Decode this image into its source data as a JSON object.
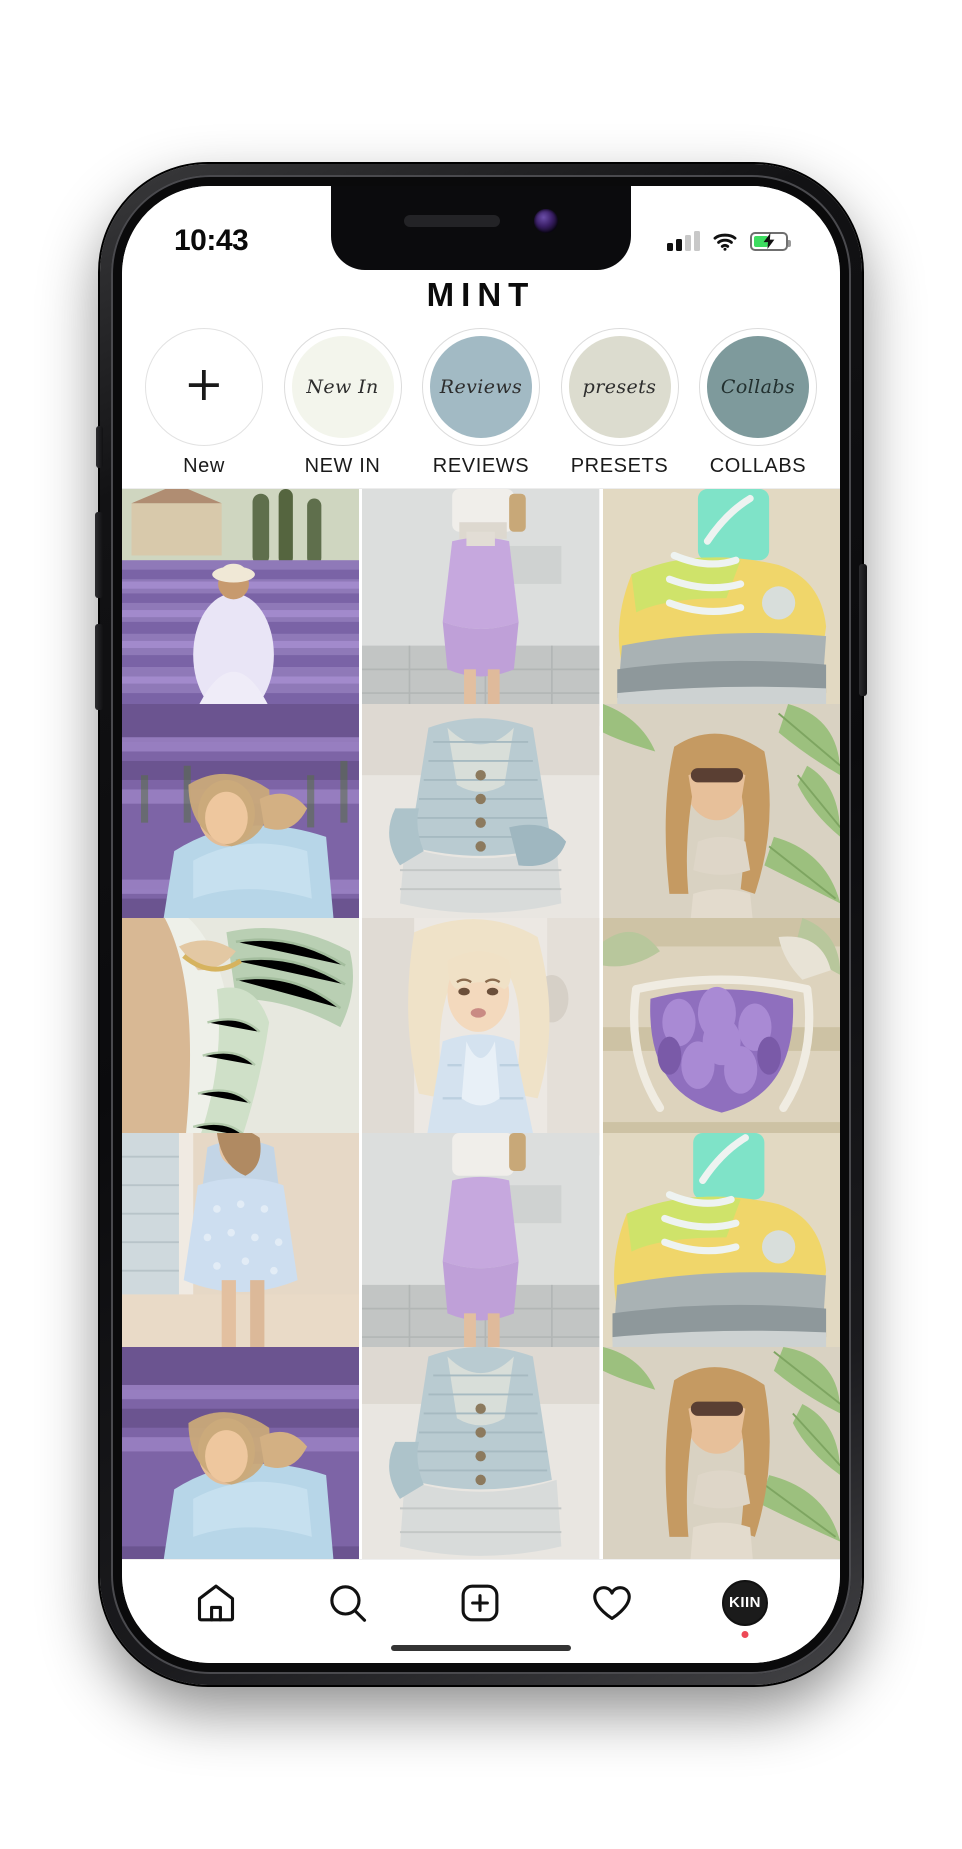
{
  "device": {
    "name": "iphone-mockup",
    "status_bar": {
      "time": "10:43",
      "signal_icon": "cellular-signal-icon",
      "signal_bars_active": 2,
      "signal_bars_total": 4,
      "wifi_icon": "wifi-icon",
      "battery_icon": "battery-charging-icon",
      "battery_level_percent": 45,
      "battery_color": "#3ddc60",
      "charging": true
    }
  },
  "header": {
    "brand_title": "MINT"
  },
  "highlights": {
    "items": [
      {
        "label": "New",
        "bubble_text": "+",
        "fill": "#ffffff",
        "ring": "#e2e2e2",
        "icon": "plus-icon"
      },
      {
        "label": "NEW IN",
        "bubble_text": "New In",
        "fill": "#f3f5ec",
        "ring": "#dcdcdc",
        "icon": "highlight-new-in"
      },
      {
        "label": "REVIEWS",
        "bubble_text": "Reviews",
        "fill": "#a2bac4",
        "ring": "#dcdcdc",
        "icon": "highlight-reviews"
      },
      {
        "label": "PRESETS",
        "bubble_text": "presets",
        "fill": "#dcdccf",
        "ring": "#dcdcdc",
        "icon": "highlight-presets"
      },
      {
        "label": "COLLABS",
        "bubble_text": "Collabs",
        "fill": "#7e9a9c",
        "ring": "#dcdcdc",
        "icon": "highlight-collabs"
      }
    ]
  },
  "feed": {
    "posts": [
      {
        "alt": "woman-in-lavender-field-white-dress",
        "sky": "#cfd9c4",
        "ground": "#8f79b8",
        "accent": "#e8e3f4",
        "scene": "lavender-field"
      },
      {
        "alt": "lilac-satin-midi-skirt-outfit",
        "sky": "#dfe1e0",
        "ground": "#c3c6c5",
        "accent": "#c9aee0",
        "scene": "studio-skirt"
      },
      {
        "alt": "pastel-chunky-sneaker-mint-socks",
        "sky": "#e8dfc9",
        "ground": "#9aa3a6",
        "accent": "#d9e86a",
        "scene": "sneaker"
      },
      {
        "alt": "woman-lying-in-lavender-blue-dress",
        "sky": "#8d6fae",
        "ground": "#6f5b91",
        "accent": "#b9d4e6",
        "scene": "lavender-lying"
      },
      {
        "alt": "blue-knit-cardigan-and-jeans",
        "sky": "#e7e4e0",
        "ground": "#d6d2cc",
        "accent": "#b7c8cf",
        "scene": "cardigan"
      },
      {
        "alt": "woman-sunglasses-palm-leaves",
        "sky": "#bcd6a8",
        "ground": "#8fae78",
        "accent": "#e3d6c4",
        "scene": "palm-portrait"
      },
      {
        "alt": "mint-pleated-scarf-gold-chain",
        "sky": "#e5e6dd",
        "ground": "#cfd8c6",
        "accent": "#b5cbb2",
        "scene": "scarf"
      },
      {
        "alt": "blonde-woman-blue-shirt-portrait",
        "sky": "#ece9e5",
        "ground": "#dcd6cf",
        "accent": "#cfe0ee",
        "scene": "blonde-portrait"
      },
      {
        "alt": "hands-holding-lavender-bouquet",
        "sky": "#ded5c0",
        "ground": "#c6bda8",
        "accent": "#9d7dc4",
        "scene": "lavender-bouquet"
      },
      {
        "alt": "blue-eyelet-dress-on-beach-deck",
        "sky": "#cfd7db",
        "ground": "#e4d5c4",
        "accent": "#bcd0e2",
        "scene": "beach-dress"
      },
      {
        "alt": "lilac-satin-midi-skirt-outfit",
        "sky": "#dfe1e0",
        "ground": "#c3c6c5",
        "accent": "#c9aee0",
        "scene": "studio-skirt"
      },
      {
        "alt": "pastel-chunky-sneaker-mint-socks",
        "sky": "#e8dfc9",
        "ground": "#9aa3a6",
        "accent": "#d9e86a",
        "scene": "sneaker"
      },
      {
        "alt": "woman-lying-in-lavender-blue-dress",
        "sky": "#8d6fae",
        "ground": "#6f5b91",
        "accent": "#b9d4e6",
        "scene": "lavender-lying"
      },
      {
        "alt": "blue-knit-cardigan-and-jeans",
        "sky": "#e7e4e0",
        "ground": "#d6d2cc",
        "accent": "#b7c8cf",
        "scene": "cardigan"
      },
      {
        "alt": "woman-sunglasses-palm-leaves",
        "sky": "#bcd6a8",
        "ground": "#8fae78",
        "accent": "#e3d6c4",
        "scene": "palm-portrait"
      }
    ]
  },
  "tabbar": {
    "items": [
      {
        "name": "home-icon",
        "label": "Home"
      },
      {
        "name": "search-icon",
        "label": "Search"
      },
      {
        "name": "add-post-icon",
        "label": "Create"
      },
      {
        "name": "heart-icon",
        "label": "Activity"
      },
      {
        "name": "profile-avatar",
        "label": "Profile",
        "initials": "KIIN",
        "notification_dot": true
      }
    ]
  }
}
